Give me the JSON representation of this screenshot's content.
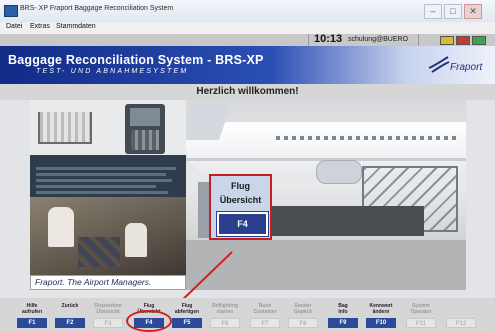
{
  "window": {
    "title": "BRS- XP Fraport Baggage Reconciliation System",
    "min": "‒",
    "max": "□",
    "close": "✕"
  },
  "menu": [
    "Datei",
    "Extras",
    "Stammdaten"
  ],
  "status": {
    "time": "10:13",
    "user": "schulung@BUERO"
  },
  "banner": {
    "title": "Baggage Reconciliation System - BRS-XP",
    "subtitle": "TEST- UND ABNAHMESYSTEM",
    "logo": "Fraport"
  },
  "welcome": "Herzlich willkommen!",
  "slogan": "Fraport. The Airport Managers.",
  "popup": {
    "line1": "Flug",
    "line2": "Übersicht",
    "key": "F4"
  },
  "fkeys": [
    {
      "l1": "Hilfe",
      "l2": "aufrufen",
      "key": "F1",
      "enabled": true
    },
    {
      "l1": "Zurück",
      "l2": "",
      "key": "F2",
      "enabled": true
    },
    {
      "l1": "Disposition",
      "l2": "Übersicht",
      "key": "F3",
      "enabled": false
    },
    {
      "l1": "Flug",
      "l2": "Übersicht",
      "key": "F4",
      "enabled": true
    },
    {
      "l1": "Flug",
      "l2": "abfertigen",
      "key": "F5",
      "enabled": true
    },
    {
      "l1": "Reflighting",
      "l2": "starten",
      "key": "F6",
      "enabled": false
    },
    {
      "l1": "Rush",
      "l2": "Container",
      "key": "F7",
      "enabled": false
    },
    {
      "l1": "Sonder",
      "l2": "Gepäck",
      "key": "F8",
      "enabled": false
    },
    {
      "l1": "Bag",
      "l2": "Info",
      "key": "F9",
      "enabled": true
    },
    {
      "l1": "Kennwort",
      "l2": "ändern",
      "key": "F10",
      "enabled": true
    },
    {
      "l1": "System",
      "l2": "Operator",
      "key": "F11",
      "enabled": false
    },
    {
      "l1": "",
      "l2": "",
      "key": "F12",
      "enabled": false
    }
  ],
  "colors": {
    "banner_dark": "#112b86",
    "key_blue": "#2d4a9a",
    "highlight_red": "#d51f1f"
  }
}
